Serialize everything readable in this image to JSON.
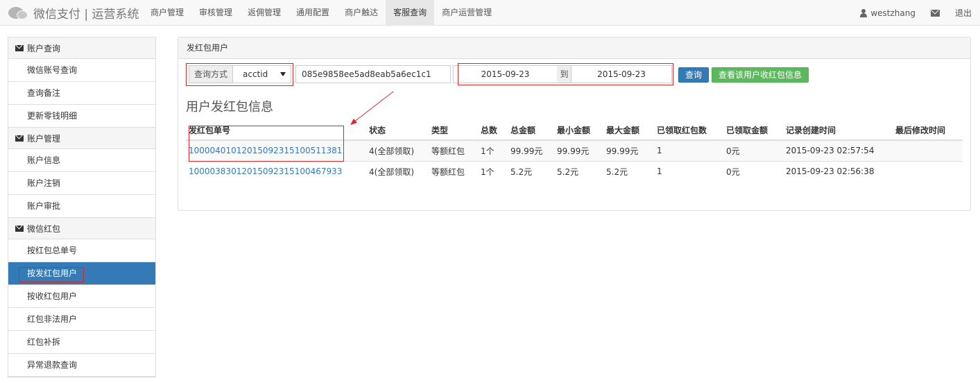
{
  "brand": {
    "title": "微信支付 | 运营系统"
  },
  "nav": {
    "items": [
      "商户管理",
      "审核管理",
      "返佣管理",
      "通用配置",
      "商户触达",
      "客服查询",
      "商户运营管理"
    ],
    "active_index": 5,
    "user": "westzhang",
    "logout": "退出"
  },
  "sidebar": {
    "groups": [
      {
        "title": "账户查询",
        "items": [
          "微信账号查询",
          "查询备注",
          "更新零钱明细"
        ]
      },
      {
        "title": "账户管理",
        "items": [
          "账户信息",
          "账户注销",
          "账户审批"
        ]
      },
      {
        "title": "微信红包",
        "items": [
          "按红包总单号",
          "按发红包用户",
          "按收红包用户",
          "红包非法用户",
          "红包补拆",
          "异常退款查询"
        ]
      }
    ],
    "active_item": "按发红包用户"
  },
  "panel": {
    "title": "发红包用户",
    "query": {
      "type_label": "查询方式",
      "type_value": "acctid",
      "id_value": "085e9858ee5ad8eab5a6ec1c1",
      "date_from": "2015-09-23",
      "date_sep": "到",
      "date_to": "2015-09-23",
      "search_button": "查询",
      "view_button": "查看该用户收红包信息"
    },
    "section_title": "用户发红包信息",
    "table": {
      "columns": [
        "发红包单号",
        "状态",
        "类型",
        "总数",
        "总金额",
        "最小金额",
        "最大金额",
        "已领取红包数",
        "已领取金额",
        "记录创建时间",
        "最后修改时间"
      ],
      "rows": [
        [
          "1000040101201509231510051138­1",
          "4(全部领取)",
          "等额红包",
          "1个",
          "99.99元",
          "99.99元",
          "99.99元",
          "1",
          "0元",
          "2015-09-23 02:57:54",
          ""
        ],
        [
          "10000383012015092315100467933",
          "4(全部领取)",
          "等额红包",
          "1个",
          "5.2元",
          "5.2元",
          "5.2元",
          "1",
          "0元",
          "2015-09-23 02:56:38",
          ""
        ]
      ]
    }
  },
  "colors": {
    "accent": "#337ab7",
    "success": "#5cb85c",
    "highlight": "#d9262b"
  }
}
